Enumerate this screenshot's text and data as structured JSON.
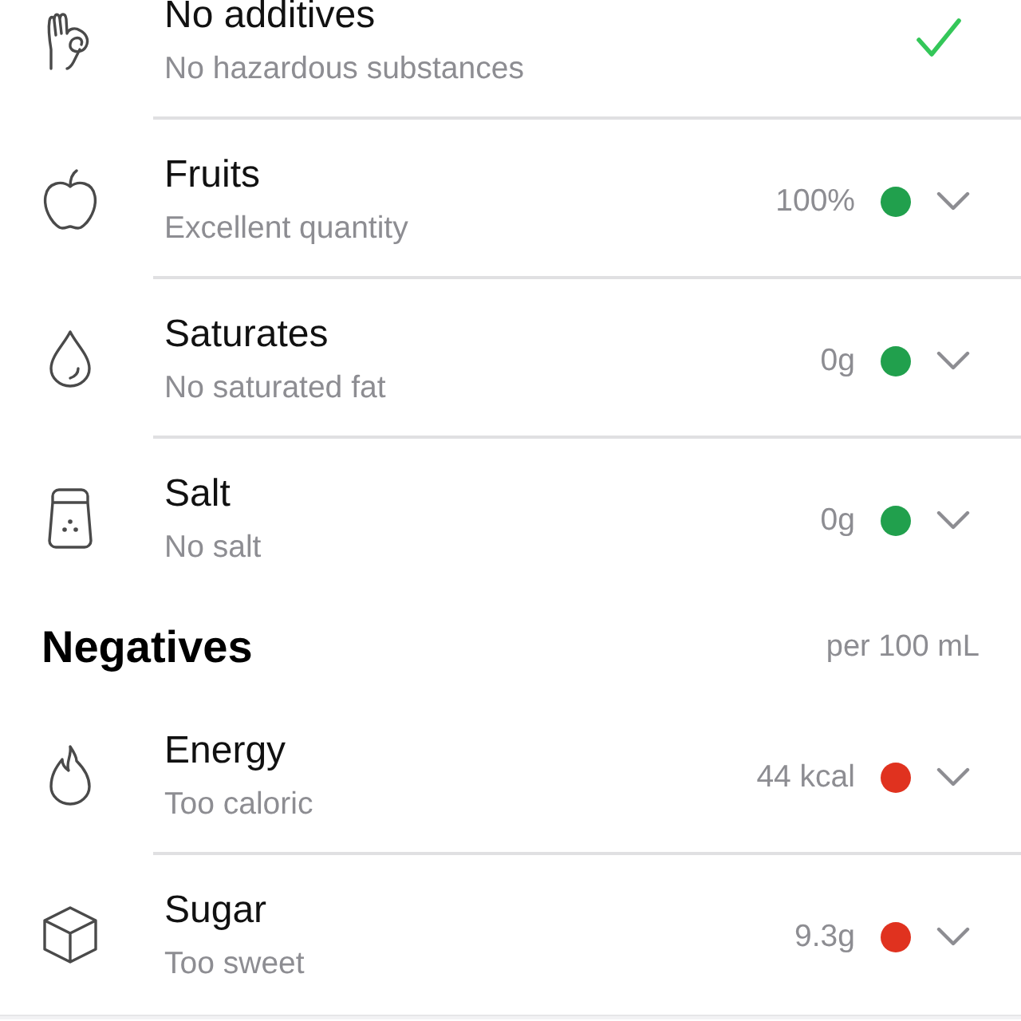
{
  "sections": [
    {
      "items": [
        {
          "kind": "check",
          "title": "No additives",
          "subtitle": "No hazardous substances"
        },
        {
          "kind": "value",
          "title": "Fruits",
          "subtitle": "Excellent quantity",
          "value": "100%",
          "color": "#21a04d"
        },
        {
          "kind": "value",
          "title": "Saturates",
          "subtitle": "No saturated fat",
          "value": "0g",
          "color": "#21a04d"
        },
        {
          "kind": "value",
          "title": "Salt",
          "subtitle": "No salt",
          "value": "0g",
          "color": "#21a04d"
        }
      ]
    },
    {
      "title": "Negatives",
      "unit": "per 100 mL",
      "items": [
        {
          "kind": "value",
          "title": "Energy",
          "subtitle": "Too caloric",
          "value": "44 kcal",
          "color": "#e0321f"
        },
        {
          "kind": "value",
          "title": "Sugar",
          "subtitle": "Too sweet",
          "value": "9.3g",
          "color": "#e0321f"
        }
      ]
    }
  ]
}
